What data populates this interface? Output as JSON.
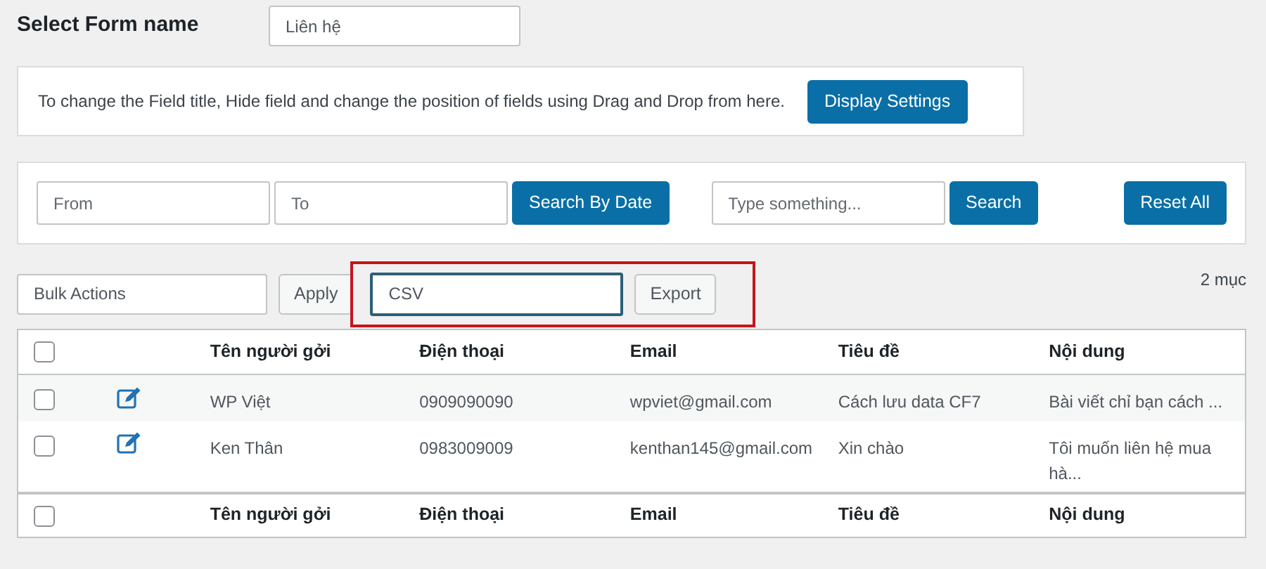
{
  "form_select": {
    "label": "Select Form name",
    "value": "Liên hệ"
  },
  "notice": {
    "text": "To change the Field title, Hide field and change the position of fields using Drag and Drop from here.",
    "button": "Display Settings"
  },
  "filters": {
    "from_placeholder": "From",
    "to_placeholder": "To",
    "date_button": "Search By Date",
    "search_placeholder": "Type something...",
    "search_button": "Search",
    "reset_button": "Reset All"
  },
  "actions": {
    "bulk": "Bulk Actions",
    "apply": "Apply",
    "export_format": "CSV",
    "export_button": "Export",
    "highlighted": true,
    "count": "2 mục"
  },
  "table": {
    "columns": [
      "Tên người gởi",
      "Điện thoại",
      "Email",
      "Tiêu đề",
      "Nội dung"
    ],
    "rows": [
      {
        "checked": false,
        "cells": [
          "WP Việt",
          "0909090090",
          "wpviet@gmail.com",
          "Cách lưu data CF7",
          "Bài viết chỉ bạn cách ..."
        ]
      },
      {
        "checked": false,
        "cells": [
          "Ken Thân",
          "0983009009",
          "kenthan145@gmail.com",
          "Xin chào",
          "Tôi muốn liên hệ mua hà..."
        ]
      }
    ],
    "footer_columns": [
      "Tên người gởi",
      "Điện thoại",
      "Email",
      "Tiêu đề",
      "Nội dung"
    ],
    "header_checked": false,
    "footer_checked": false
  }
}
